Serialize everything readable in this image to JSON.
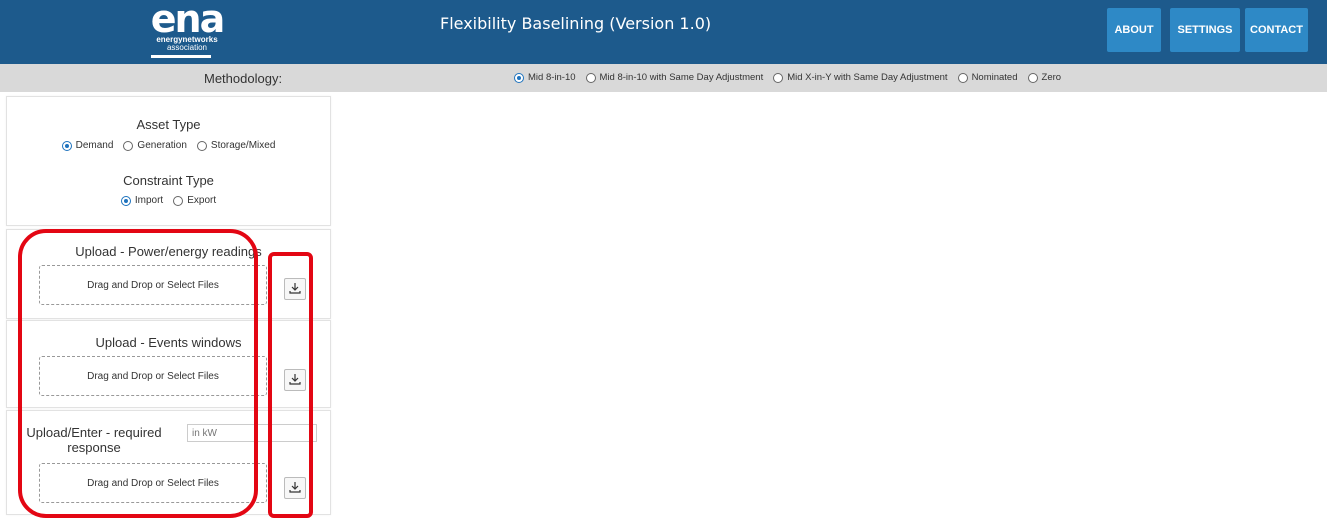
{
  "header": {
    "logo": {
      "main": "ena",
      "line1": "energynetworks",
      "line2": "association"
    },
    "title": "Flexibility Baselining (Version 1.0)",
    "nav": [
      "ABOUT",
      "SETTINGS",
      "CONTACT"
    ]
  },
  "methodology": {
    "label": "Methodology:",
    "options": [
      "Mid 8-in-10",
      "Mid 8-in-10 with Same Day Adjustment",
      "Mid X-in-Y with Same Day Adjustment",
      "Nominated",
      "Zero"
    ],
    "selected": "Mid 8-in-10"
  },
  "asset_type": {
    "title": "Asset Type",
    "options": [
      "Demand",
      "Generation",
      "Storage/Mixed"
    ],
    "selected": "Demand"
  },
  "constraint_type": {
    "title": "Constraint Type",
    "options": [
      "Import",
      "Export"
    ],
    "selected": "Import"
  },
  "upload_power": {
    "title": "Upload - Power/energy readings",
    "dropzone": "Drag and Drop or Select Files"
  },
  "upload_events": {
    "title": "Upload - Events windows",
    "dropzone": "Drag and Drop or Select Files"
  },
  "upload_response": {
    "title": "Upload/Enter - required response",
    "input_placeholder": "in kW",
    "dropzone": "Drag and Drop or Select Files"
  },
  "icons": {
    "download": "download-icon"
  },
  "colors": {
    "header": "#1d5a8c",
    "nav_button": "#2e89c6",
    "annotation": "#e30613",
    "method_bar": "#d9d9d9"
  }
}
